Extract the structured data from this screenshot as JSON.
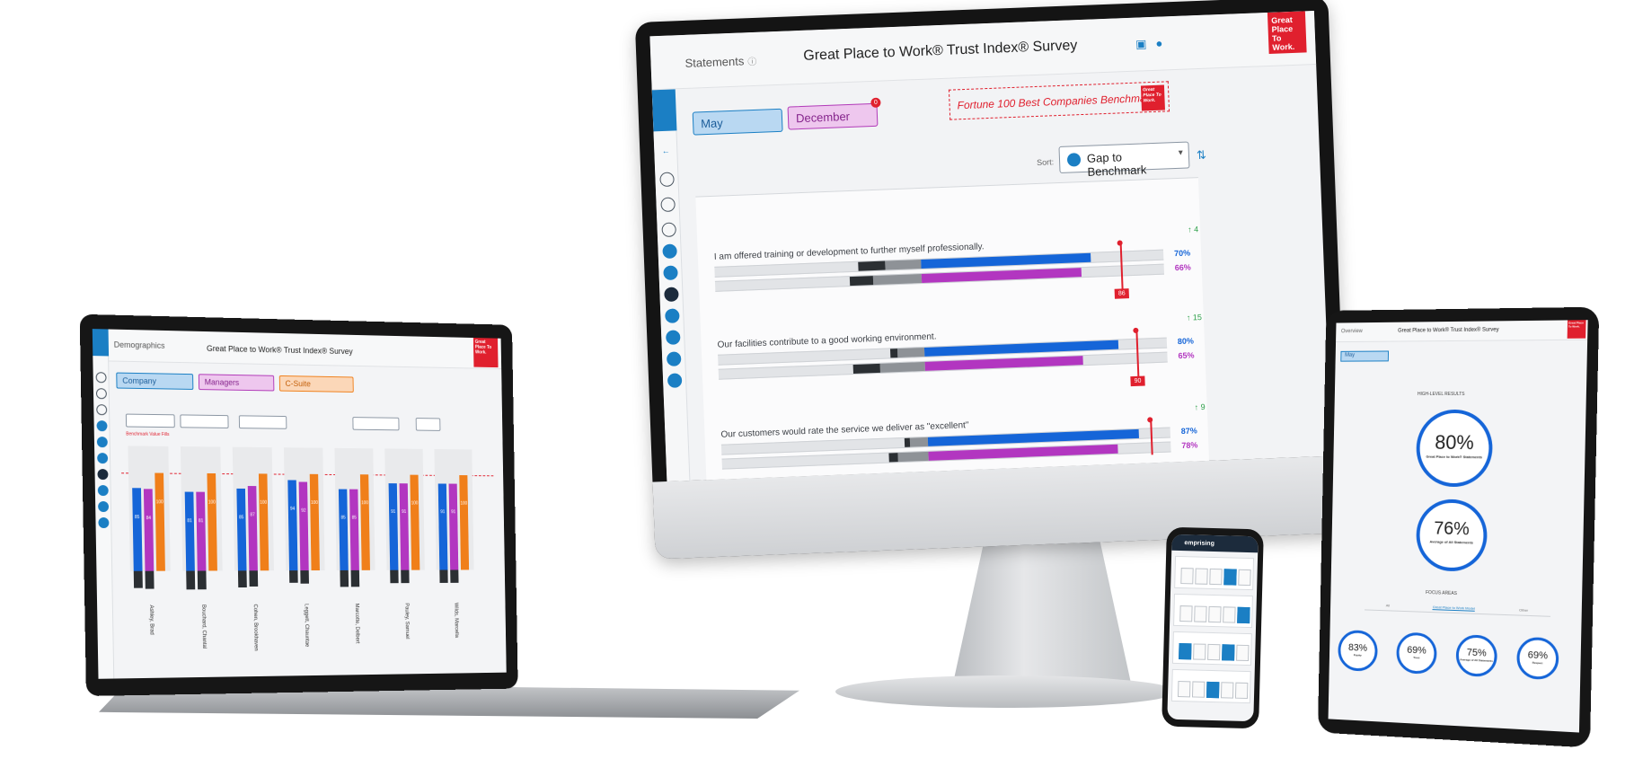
{
  "monitor": {
    "section": "Statements",
    "title": "Great Place to Work® Trust Index® Survey",
    "brand": "Great Place To Work.",
    "tabs": [
      {
        "label": "May"
      },
      {
        "label": "December",
        "badge": "0"
      }
    ],
    "benchmark_label": "Fortune 100 Best Companies Benchmark",
    "sort": {
      "label": "Sort:",
      "value": "Gap to Benchmark"
    },
    "statements": [
      {
        "text": "I am offered training or development to further myself professionally.",
        "delta": "↑ 4",
        "benchmark_tag": "86",
        "values": [
          "70%",
          "66%"
        ],
        "fills": [
          0.7,
          0.66
        ]
      },
      {
        "text": "Our facilities contribute to a good working environment.",
        "delta": "↑ 15",
        "benchmark_tag": "90",
        "values": [
          "80%",
          "65%"
        ],
        "fills": [
          0.8,
          0.65
        ]
      },
      {
        "text": "Our customers would rate the service we deliver as \"excellent\"",
        "delta": "↑ 9",
        "benchmark_tag": "",
        "values": [
          "87%",
          "78%"
        ],
        "fills": [
          0.87,
          0.78
        ]
      }
    ],
    "accent_blue": "#1565d8",
    "accent_purple": "#b236c0",
    "brand_red": "#e0202e"
  },
  "laptop": {
    "section": "Demographics",
    "title": "Great Place to Work® Trust Index® Survey",
    "tabs": [
      {
        "label": "Company"
      },
      {
        "label": "Managers"
      },
      {
        "label": "C-Suite"
      }
    ],
    "benchmark_note": "Benchmark Value Fills",
    "groups": [
      {
        "name": "Ashley, Brad",
        "values": [
          85,
          84,
          100
        ]
      },
      {
        "name": "Bouchard, Chantal",
        "values": [
          81,
          81,
          100
        ]
      },
      {
        "name": "Cohen, Brookhaven",
        "values": [
          85,
          87,
          100
        ]
      },
      {
        "name": "Leggett, Chauntae",
        "values": [
          94,
          92,
          100
        ]
      },
      {
        "name": "Marcotte, Delbert",
        "values": [
          85,
          85,
          100
        ]
      },
      {
        "name": "Pauley, Samuel",
        "values": [
          91,
          91,
          100
        ]
      },
      {
        "name": "Wilds, Marcella",
        "values": [
          91,
          91,
          100
        ]
      }
    ]
  },
  "tablet": {
    "section": "Overview",
    "title": "Great Place to Work® Trust Index® Survey",
    "tab": "May",
    "high_level_heading": "HIGH-LEVEL RESULTS",
    "rings": [
      {
        "value": "80%",
        "label": "Great Place to Work® Statements"
      },
      {
        "value": "76%",
        "label": "Average of All Statements"
      }
    ],
    "focus_heading": "FOCUS AREAS",
    "focus_tabs": [
      "All",
      "Great Place to Work Model",
      "Other"
    ],
    "focus_rings": [
      {
        "value": "83%",
        "label": "Equity"
      },
      {
        "value": "69%",
        "label": "Trust"
      },
      {
        "value": "75%",
        "label": "Average of All Statements"
      },
      {
        "value": "69%",
        "label": "Respect"
      }
    ]
  },
  "phone": {
    "app_name": "emprising"
  }
}
